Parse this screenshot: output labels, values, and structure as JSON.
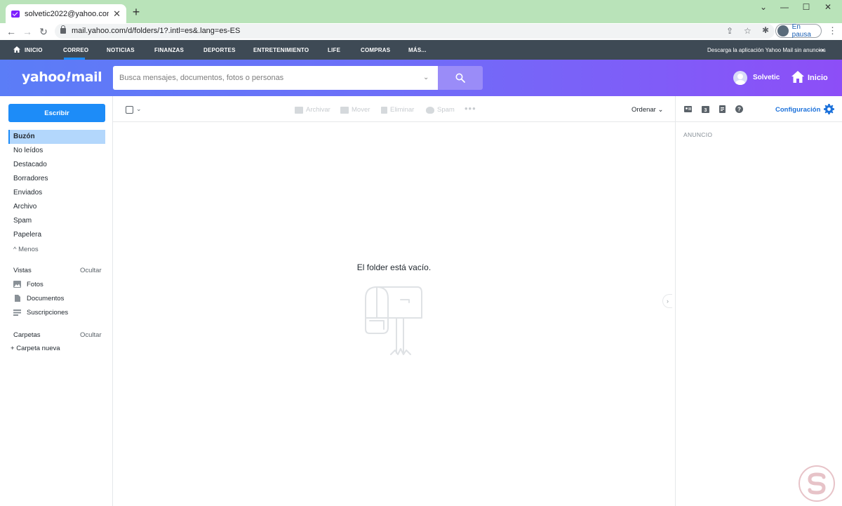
{
  "browser": {
    "tab_title": "solvetic2022@yahoo.com - Yaho",
    "tab_close": "✕",
    "new_tab": "+",
    "window_controls": [
      "⌄",
      "—",
      "☐",
      "✕"
    ],
    "url": "mail.yahoo.com/d/folders/1?.intl=es&.lang=es-ES",
    "profile_label": "En pausa",
    "nav_back": "←",
    "nav_forward": "→",
    "nav_reload": "↻",
    "menu": "⋮"
  },
  "topnav": {
    "items": [
      "INICIO",
      "CORREO",
      "NOTICIAS",
      "FINANZAS",
      "DEPORTES",
      "ENTRETENIMIENTO",
      "LIFE",
      "COMPRAS",
      "MÁS..."
    ],
    "active": "CORREO",
    "promo": "Descarga la aplicación Yahoo Mail sin anuncios",
    "arrow": "→"
  },
  "header": {
    "logo_text": "yahoo",
    "logo_bang": "!",
    "logo_suffix": "mail",
    "search_placeholder": "Busca mensajes, documentos, fotos o personas",
    "user_name": "Solvetic",
    "home_label": "Inicio",
    "colors": {
      "gradient_start": "#5b7df7",
      "gradient_end": "#8d4ef7",
      "search_button": "#9a8cf8"
    }
  },
  "sidebar": {
    "compose_label": "Escribir",
    "folders": [
      "Buzón",
      "No leídos",
      "Destacado",
      "Borradores",
      "Enviados",
      "Archivo",
      "Spam",
      "Papelera"
    ],
    "active_folder": "Buzón",
    "less_label": "Menos",
    "views_title": "Vistas",
    "views_action": "Ocultar",
    "views": [
      {
        "label": "Fotos",
        "icon": "photo-icon"
      },
      {
        "label": "Documentos",
        "icon": "document-icon"
      },
      {
        "label": "Suscripciones",
        "icon": "subscriptions-icon"
      }
    ],
    "folders_title": "Carpetas",
    "folders_action": "Ocultar",
    "new_folder": "Carpeta nueva",
    "accent": "#1d8cf8"
  },
  "main": {
    "actions": [
      {
        "label": "Archivar",
        "icon": "archive-icon"
      },
      {
        "label": "Mover",
        "icon": "move-icon"
      },
      {
        "label": "Eliminar",
        "icon": "trash-icon"
      },
      {
        "label": "Spam",
        "icon": "spam-icon"
      }
    ],
    "more": "•••",
    "sort_label": "Ordenar",
    "empty_message": "El folder está vacío.",
    "collapse": "›"
  },
  "rightpanel": {
    "icons": [
      "contacts-icon",
      "calendar-icon",
      "notepad-icon",
      "help-icon"
    ],
    "config_label": "Configuración",
    "ad_label": "ANUNCIO"
  }
}
